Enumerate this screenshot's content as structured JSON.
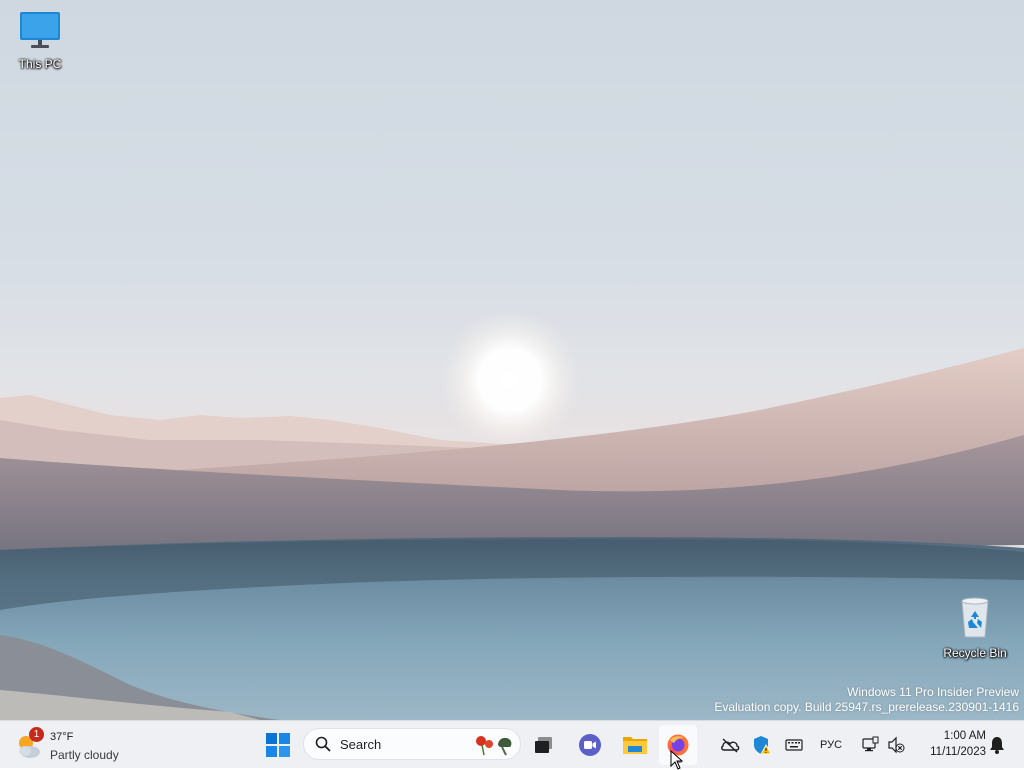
{
  "desktop": {
    "icons": [
      {
        "label": "This PC",
        "icon": "monitor-icon"
      },
      {
        "label": "Recycle Bin",
        "icon": "recycle-bin-icon"
      }
    ],
    "watermark": {
      "line1": "Windows 11 Pro Insider Preview",
      "line2": "Evaluation copy. Build 25947.rs_prerelease.230901-1416"
    }
  },
  "taskbar": {
    "weather": {
      "temperature": "37°F",
      "condition": "Partly cloudy",
      "badge": "1"
    },
    "search": {
      "placeholder": "Search"
    },
    "apps": [
      {
        "name": "start-button",
        "icon": "windows-logo-icon"
      },
      {
        "name": "task-view",
        "icon": "task-view-icon"
      },
      {
        "name": "meet",
        "icon": "video-chat-icon"
      },
      {
        "name": "file-explorer",
        "icon": "folder-icon"
      },
      {
        "name": "firefox",
        "icon": "firefox-icon",
        "active": true
      }
    ],
    "tray": {
      "language": "РУС",
      "icons": [
        "onedrive-offline-icon",
        "defender-warning-icon",
        "keyboard-icon",
        "network-icon",
        "volume-muted-icon",
        "notification-bell-icon"
      ]
    },
    "clock": {
      "time": "1:00 AM",
      "date": "11/11/2023"
    }
  },
  "colors": {
    "taskbar_bg": "#eef0f4",
    "start_blue": "#0a74d6",
    "badge_red": "#c42b1c"
  }
}
